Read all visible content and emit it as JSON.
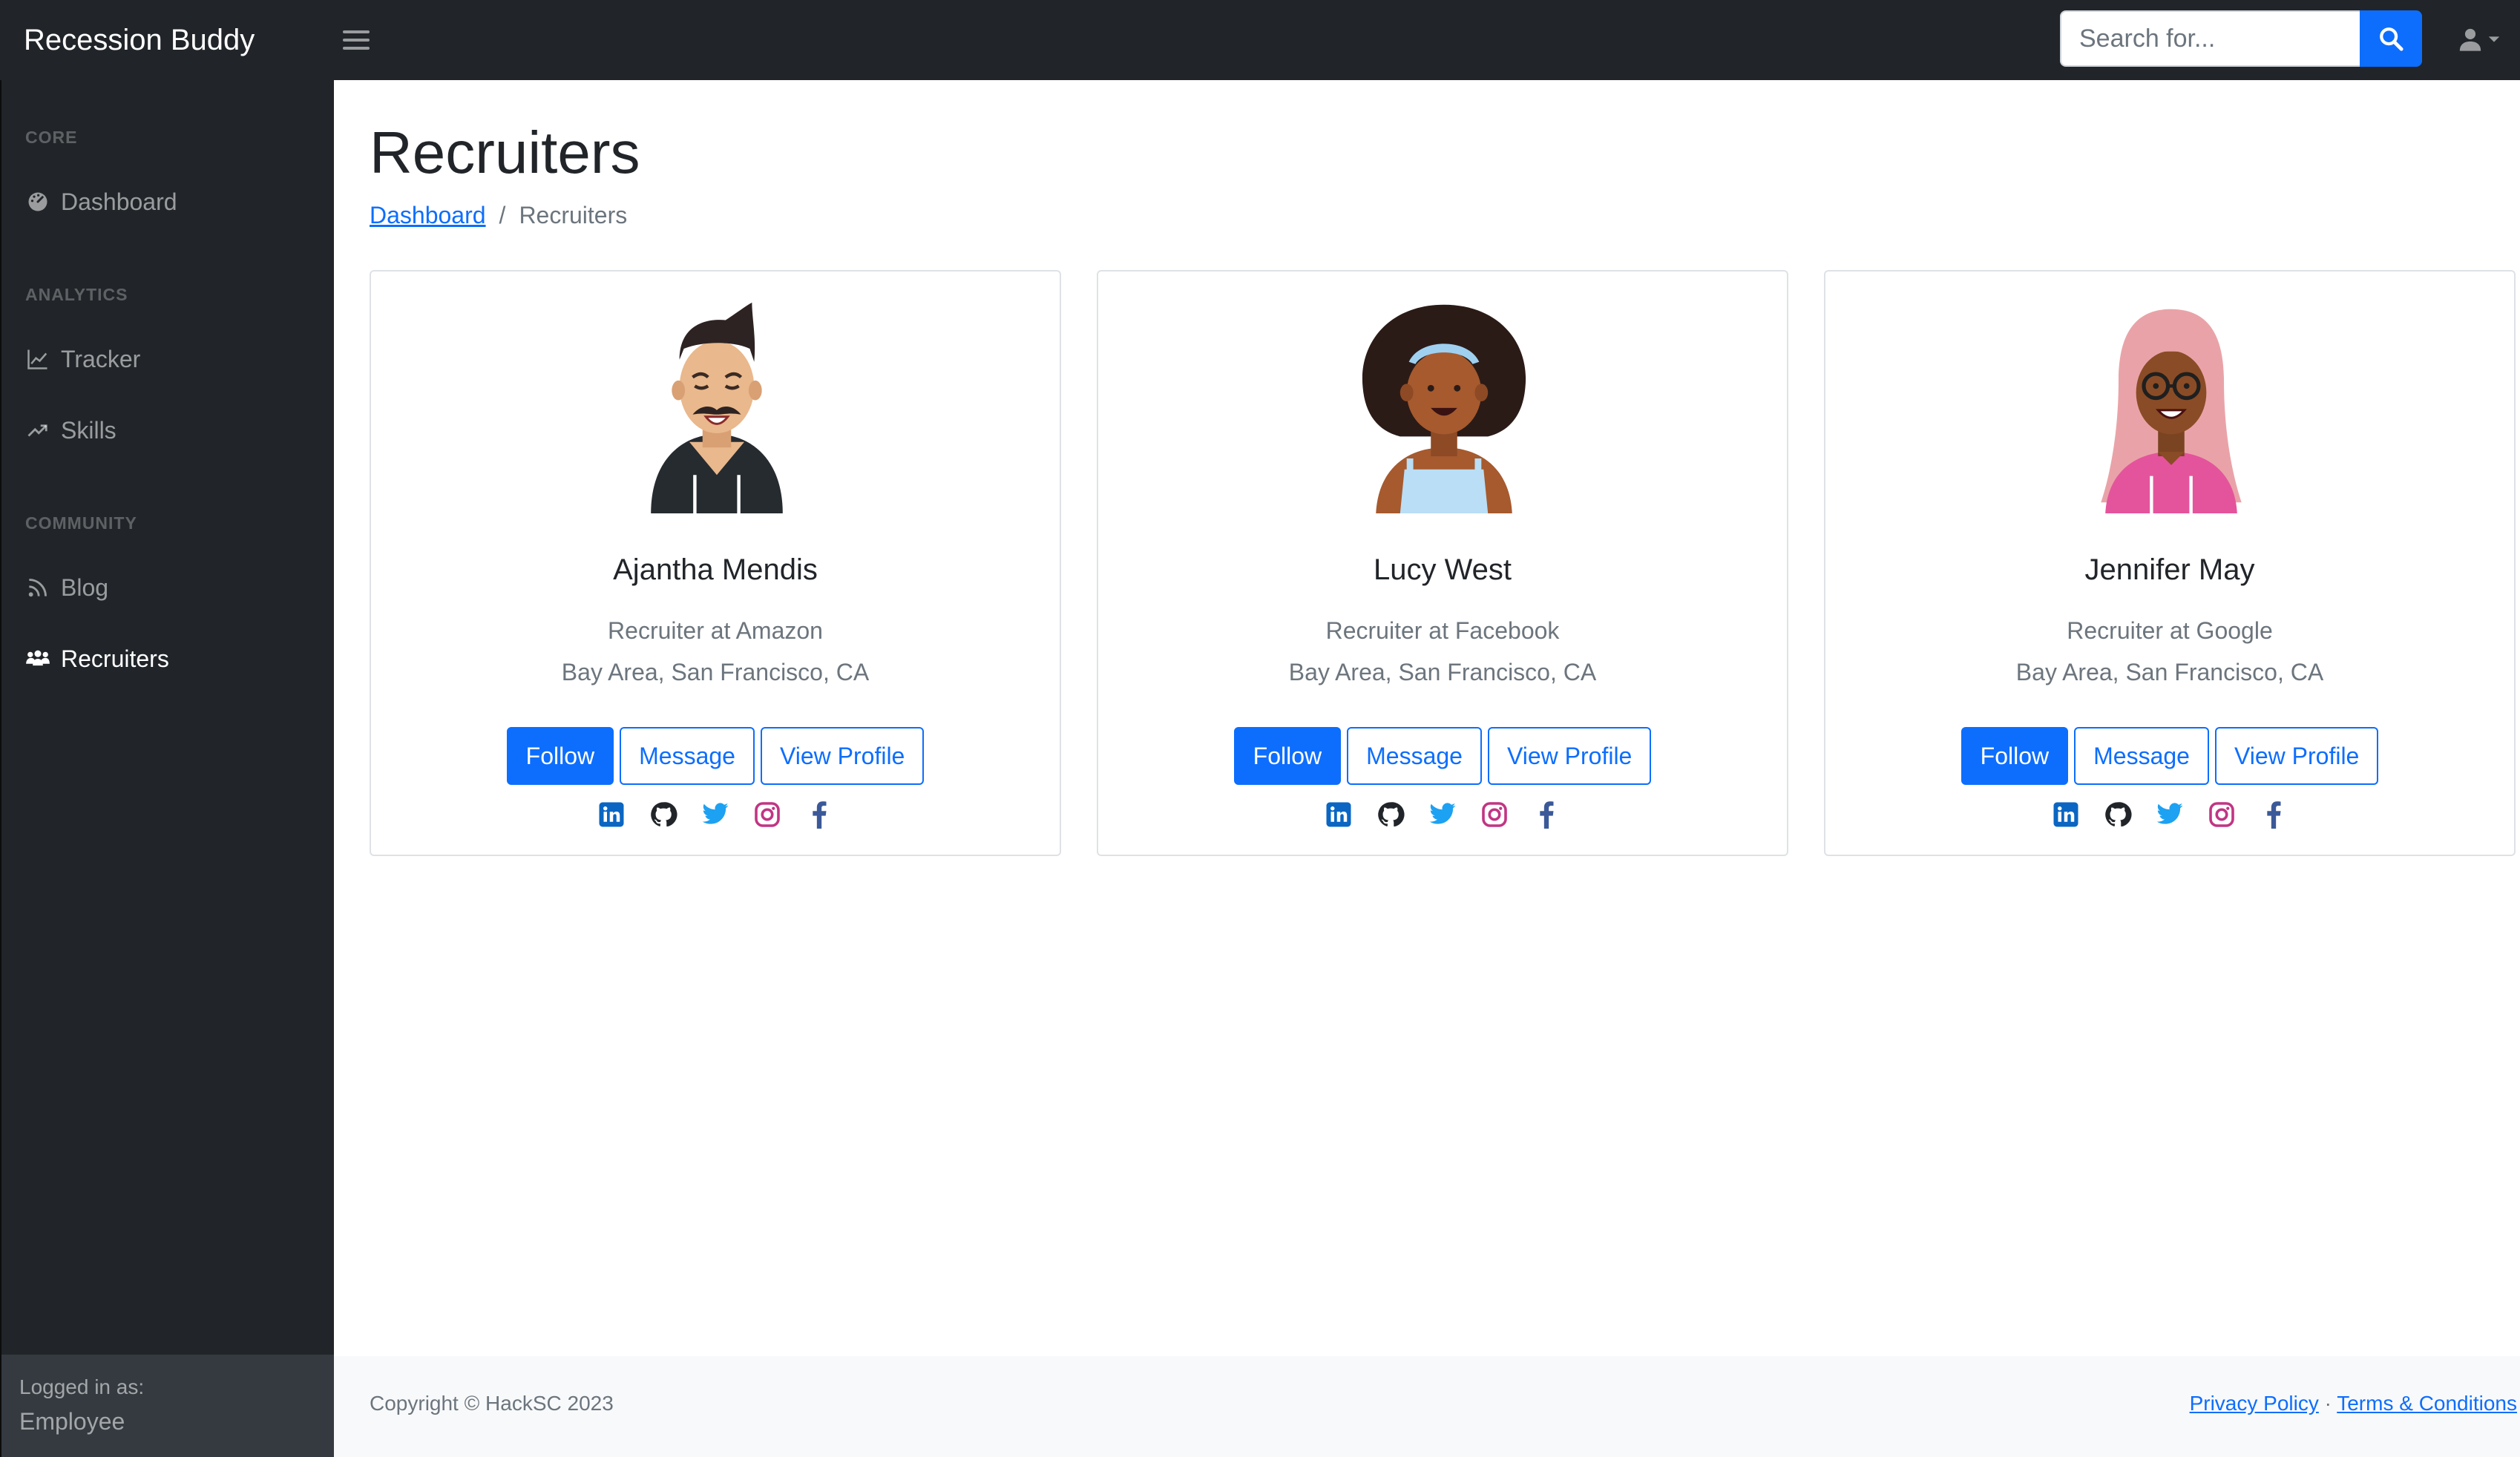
{
  "app": {
    "brand": "Recession Buddy"
  },
  "search": {
    "placeholder": "Search for..."
  },
  "sidebar": {
    "sections": [
      {
        "heading": "CORE",
        "items": [
          {
            "label": "Dashboard",
            "icon": "tachometer-icon"
          }
        ]
      },
      {
        "heading": "ANALYTICS",
        "items": [
          {
            "label": "Tracker",
            "icon": "chart-line-icon"
          },
          {
            "label": "Skills",
            "icon": "trend-up-icon"
          }
        ]
      },
      {
        "heading": "COMMUNITY",
        "items": [
          {
            "label": "Blog",
            "icon": "rss-icon"
          },
          {
            "label": "Recruiters",
            "icon": "users-icon",
            "active": true
          }
        ]
      }
    ],
    "footer": {
      "logged_in_label": "Logged in as:",
      "role": "Employee"
    }
  },
  "page": {
    "title": "Recruiters",
    "breadcrumb": {
      "link": "Dashboard",
      "separator": "/",
      "current": "Recruiters"
    }
  },
  "buttons": {
    "follow": "Follow",
    "message": "Message",
    "view_profile": "View Profile"
  },
  "recruiters": [
    {
      "name": "Ajantha Mendis",
      "title": "Recruiter at Amazon",
      "location": "Bay Area, San Francisco, CA",
      "avatar": "man-mustache-avatar"
    },
    {
      "name": "Lucy West",
      "title": "Recruiter at Facebook",
      "location": "Bay Area, San Francisco, CA",
      "avatar": "woman-afro-avatar"
    },
    {
      "name": "Jennifer May",
      "title": "Recruiter at Google",
      "location": "Bay Area, San Francisco, CA",
      "avatar": "woman-pink-hair-avatar"
    }
  ],
  "social": [
    {
      "icon": "linkedin-icon",
      "color": "#0a66c2"
    },
    {
      "icon": "github-icon",
      "color": "#212529"
    },
    {
      "icon": "twitter-icon",
      "color": "#1da1f2"
    },
    {
      "icon": "instagram-icon",
      "color": "#c13584"
    },
    {
      "icon": "facebook-icon",
      "color": "#3b5998"
    }
  ],
  "footer": {
    "copyright": "Copyright © HackSC 2023",
    "privacy": "Privacy Policy",
    "dot": "·",
    "terms": "Terms & Conditions"
  },
  "colors": {
    "primary": "#0d6efd",
    "sidebar_bg": "#212529",
    "footer_bg": "#f8f9fa"
  }
}
